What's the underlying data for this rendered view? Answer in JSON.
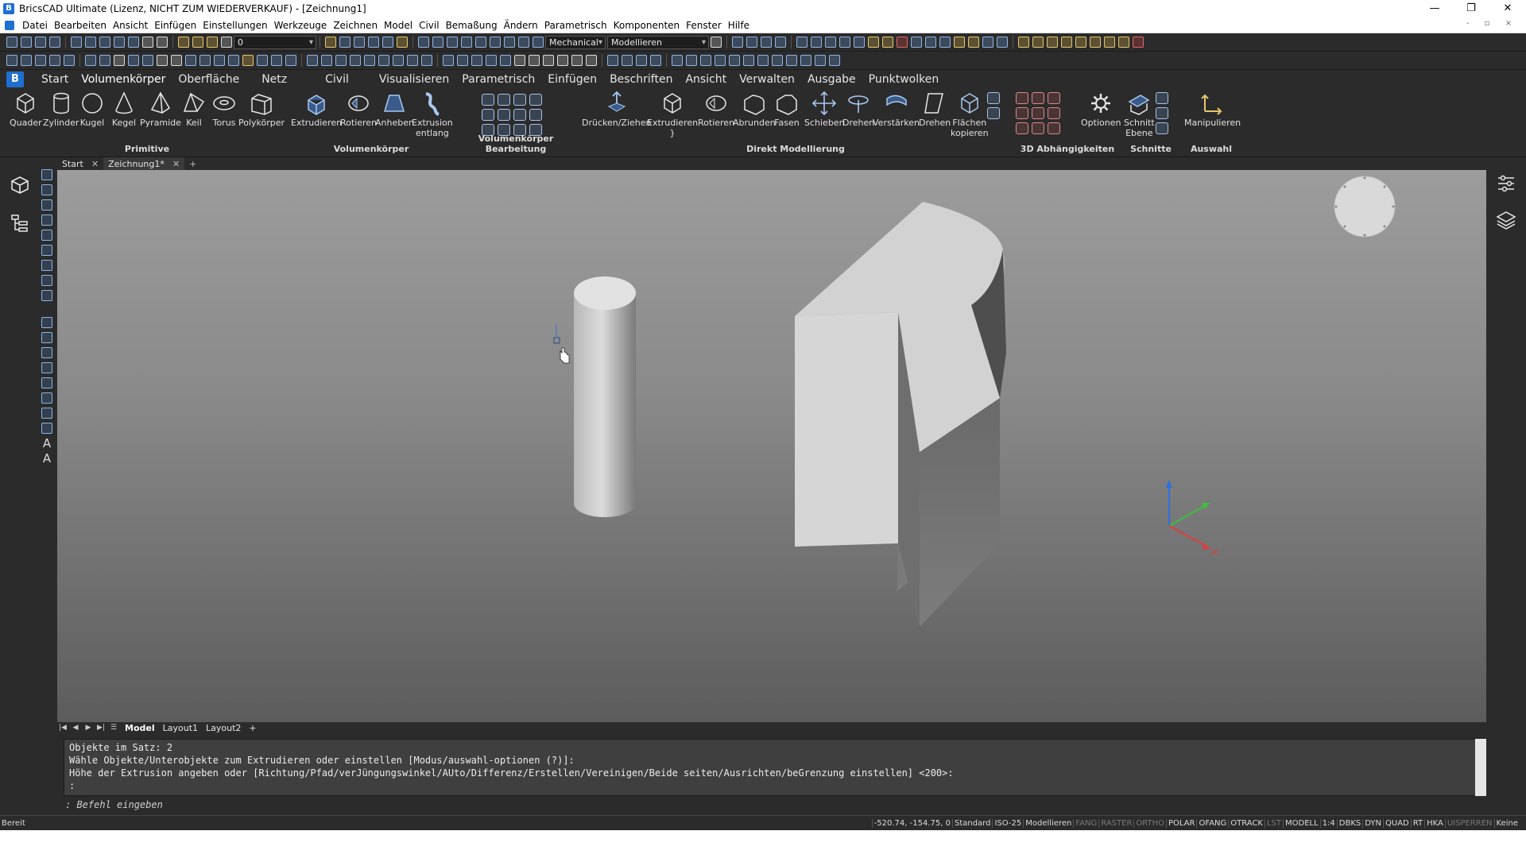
{
  "window": {
    "title": "BricsCAD Ultimate (Lizenz, NICHT ZUM WIEDERVERKAUF) - [Zeichnung1]",
    "minimize": "—",
    "restore": "❐",
    "close": "✕"
  },
  "menu": [
    "Datei",
    "Bearbeiten",
    "Ansicht",
    "Einfügen",
    "Einstellungen",
    "Werkzeuge",
    "Zeichnen",
    "Model",
    "Civil",
    "Bemaßung",
    "Ändern",
    "Parametrisch",
    "Komponenten",
    "Fenster",
    "Hilfe"
  ],
  "toolbar": {
    "layer_value": "0",
    "workspace_value": "Mechanical",
    "mode_value": "Modellieren"
  },
  "ribbon_tabs": [
    "Start",
    "Volumenkörper",
    "Oberfläche",
    "Netz",
    "Civil",
    "Visualisieren",
    "Parametrisch",
    "Einfügen",
    "Beschriften",
    "Ansicht",
    "Verwalten",
    "Ausgabe",
    "Punktwolken"
  ],
  "ribbon": {
    "primitive": {
      "title": "Primitive",
      "buttons": [
        "Quader",
        "Zylinder",
        "Kugel",
        "Kegel",
        "Pyramide",
        "Keil",
        "Torus",
        "Polykörper"
      ]
    },
    "volumenkoerper": {
      "title": "Volumenkörper",
      "buttons": [
        "Extrudieren",
        "Rotieren",
        "Anheben",
        "Extrusion\nentlang"
      ]
    },
    "bearbeitung": {
      "title": "Volumenkörper Bearbeitung"
    },
    "direkt": {
      "title": "Direkt Modellierung",
      "buttons": [
        "Drücken/Ziehen",
        "Extrudieren",
        "Rotieren",
        "Abrunden",
        "Fasen",
        "Schieben",
        "Drehen",
        "Verstärken",
        "Drehen",
        "Flächen\nkopieren"
      ]
    },
    "abhaengigkeiten": {
      "title": "3D Abhängigkeiten",
      "optionen": "Optionen"
    },
    "schnitte": {
      "title": "Schnitte",
      "button": "Schnitt\nEbene"
    },
    "auswahl": {
      "title": "Auswahl",
      "button": "Manipulieren"
    }
  },
  "doc_tabs": [
    {
      "label": "Start"
    },
    {
      "label": "Zeichnung1*"
    }
  ],
  "layout_tabs": [
    "Model",
    "Layout1",
    "Layout2",
    "+"
  ],
  "command": {
    "history": [
      "Objekte im Satz: 2",
      "Wähle Objekte/Unterobjekte zum Extrudieren oder einstellen [Modus/auswahl-optionen (?)]:",
      "Höhe der Extrusion angeben oder [Richtung/Pfad/verJüngungswinkel/AUto/Differenz/Erstellen/Vereinigen/Beide seiten/Ausrichten/beGrenzung einstellen] <200>:",
      ":"
    ],
    "prompt": ": Befehl eingeben"
  },
  "status": {
    "ready": "Bereit",
    "coords": "-520.74, -154.75, 0",
    "items": [
      {
        "label": "Standard",
        "on": true
      },
      {
        "label": "ISO-25",
        "on": true
      },
      {
        "label": "Modellieren",
        "on": true
      },
      {
        "label": "FANG",
        "on": false
      },
      {
        "label": "RASTER",
        "on": false
      },
      {
        "label": "ORTHO",
        "on": false
      },
      {
        "label": "POLAR",
        "on": true
      },
      {
        "label": "OFANG",
        "on": true
      },
      {
        "label": "OTRACK",
        "on": true
      },
      {
        "label": "LST",
        "on": false
      },
      {
        "label": "MODELL",
        "on": true
      },
      {
        "label": "1:4",
        "on": true
      },
      {
        "label": "DBKS",
        "on": true
      },
      {
        "label": "DYN",
        "on": true
      },
      {
        "label": "QUAD",
        "on": true
      },
      {
        "label": "RT",
        "on": true
      },
      {
        "label": "HKA",
        "on": true
      },
      {
        "label": "UISPERREN",
        "on": false
      },
      {
        "label": "Keine",
        "on": true
      }
    ]
  },
  "colors": {
    "accent": "#1f6fd1",
    "ui_dark": "#2b2b2b",
    "axis_x": "#e03c3c",
    "axis_y": "#3cc03c",
    "axis_z": "#2f6fe0"
  }
}
